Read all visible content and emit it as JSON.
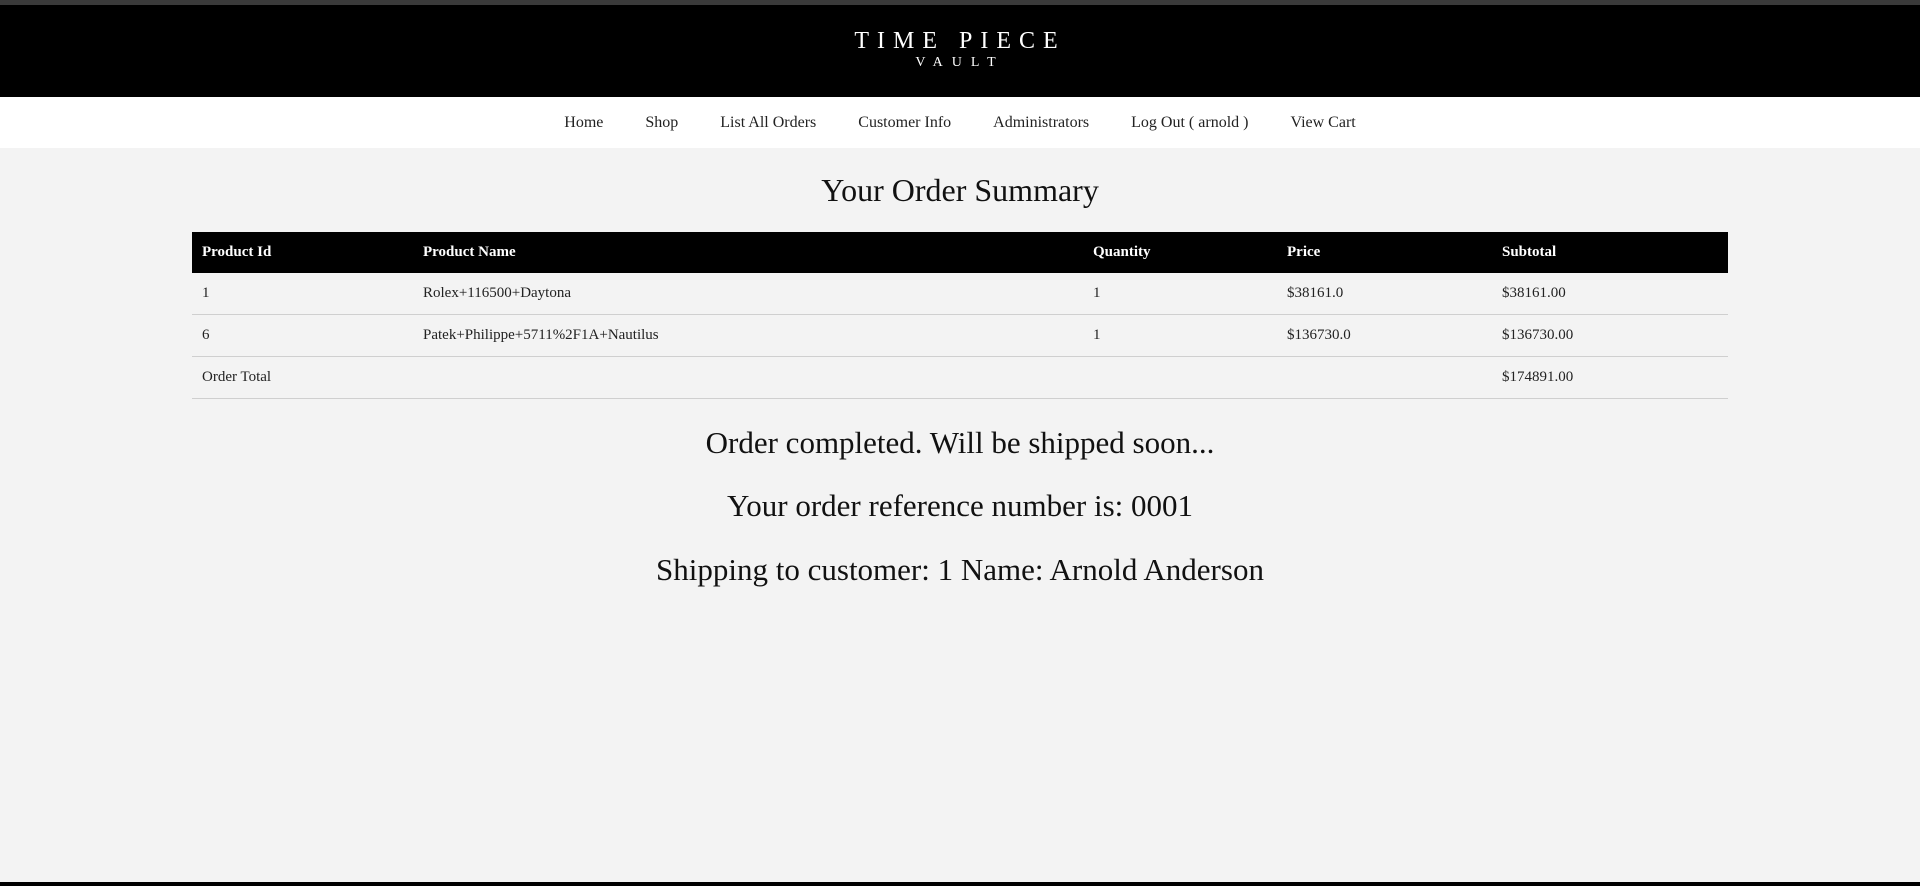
{
  "header": {
    "logo_main": "TIME PIECE",
    "logo_sub": "VAULT"
  },
  "nav": {
    "items": [
      {
        "label": "Home"
      },
      {
        "label": "Shop"
      },
      {
        "label": "List All Orders"
      },
      {
        "label": "Customer Info"
      },
      {
        "label": "Administrators"
      },
      {
        "label": "Log Out ( arnold )"
      },
      {
        "label": "View Cart"
      }
    ]
  },
  "main": {
    "title": "Your Order Summary",
    "table": {
      "headers": [
        "Product Id",
        "Product Name",
        "Quantity",
        "Price",
        "Subtotal"
      ],
      "rows": [
        {
          "id": "1",
          "name": "Rolex+116500+Daytona",
          "quantity": "1",
          "price": "$38161.0",
          "subtotal": "$38161.00"
        },
        {
          "id": "6",
          "name": "Patek+Philippe+5711%2F1A+Nautilus",
          "quantity": "1",
          "price": "$136730.0",
          "subtotal": "$136730.00"
        }
      ],
      "total_label": "Order Total",
      "total_value": "$174891.00"
    },
    "status": "Order completed. Will be shipped soon...",
    "reference": "Your order reference number is: 0001",
    "shipping": "Shipping to customer: 1 Name: Arnold Anderson"
  }
}
